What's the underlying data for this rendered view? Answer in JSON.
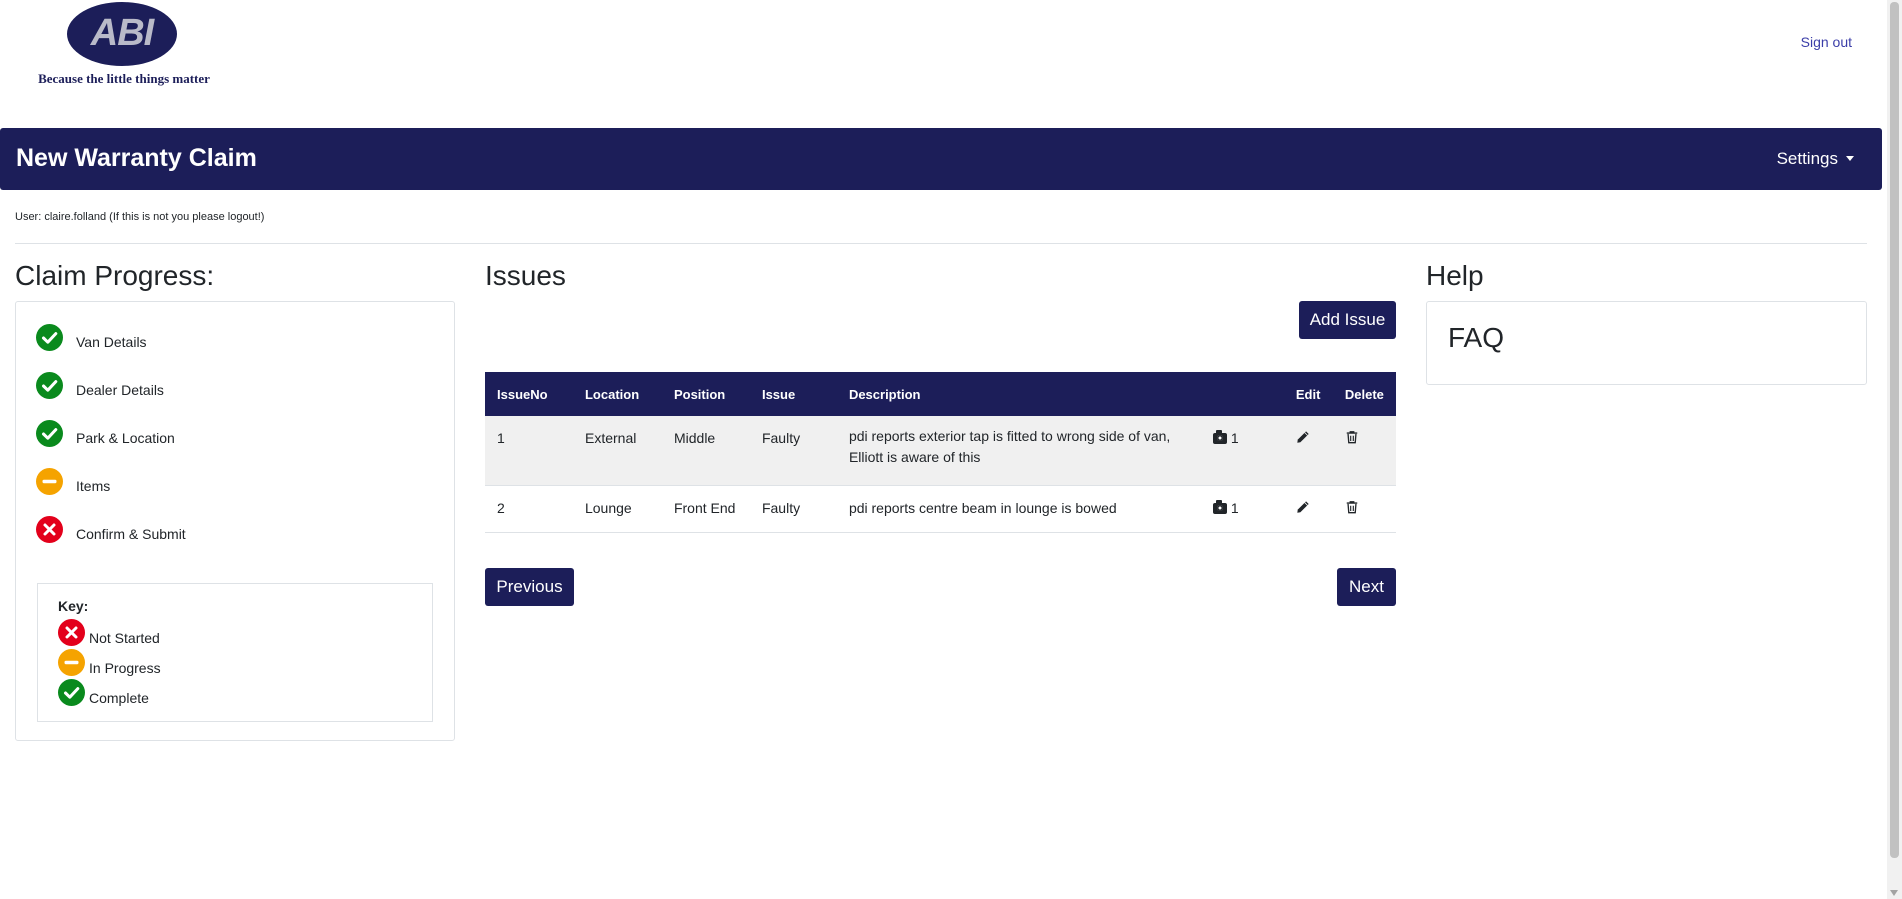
{
  "header": {
    "logo_text": "ABI",
    "tagline": "Because the little things matter",
    "signout_label": "Sign out"
  },
  "navbar": {
    "title": "New Warranty Claim",
    "settings_label": "Settings"
  },
  "user_line": "User: claire.folland (If this is not you please logout!)",
  "progress": {
    "heading": "Claim Progress:",
    "steps": [
      {
        "label": "Van Details",
        "status": "complete"
      },
      {
        "label": "Dealer Details",
        "status": "complete"
      },
      {
        "label": "Park & Location",
        "status": "complete"
      },
      {
        "label": "Items",
        "status": "in-progress"
      },
      {
        "label": "Confirm & Submit",
        "status": "not-started"
      }
    ],
    "key": {
      "title": "Key:",
      "items": [
        {
          "label": "Not Started",
          "status": "not-started"
        },
        {
          "label": "In Progress",
          "status": "in-progress"
        },
        {
          "label": "Complete",
          "status": "complete"
        }
      ]
    }
  },
  "issues": {
    "heading": "Issues",
    "add_label": "Add Issue",
    "columns": [
      "IssueNo",
      "Location",
      "Position",
      "Issue",
      "Description",
      "",
      "Edit",
      "Delete"
    ],
    "rows": [
      {
        "no": "1",
        "location": "External",
        "position": "Middle",
        "issue": "Faulty",
        "description": "pdi reports exterior tap is fitted to wrong side of van, Elliott is aware of this",
        "photos": "1"
      },
      {
        "no": "2",
        "location": "Lounge",
        "position": "Front End",
        "issue": "Faulty",
        "description": "pdi reports centre beam in lounge is bowed",
        "photos": "1"
      }
    ],
    "previous_label": "Previous",
    "next_label": "Next"
  },
  "help": {
    "heading": "Help",
    "faq_label": "FAQ"
  },
  "colors": {
    "brand": "#1c1e59",
    "complete": "#0a8a1d",
    "in_progress": "#f5a300",
    "not_started": "#e3001b"
  },
  "icons": {
    "complete": "check-circle-icon",
    "in_progress": "dash-circle-icon",
    "not_started": "x-circle-icon",
    "photo": "camera-icon",
    "edit": "pencil-icon",
    "delete": "trash-icon"
  }
}
